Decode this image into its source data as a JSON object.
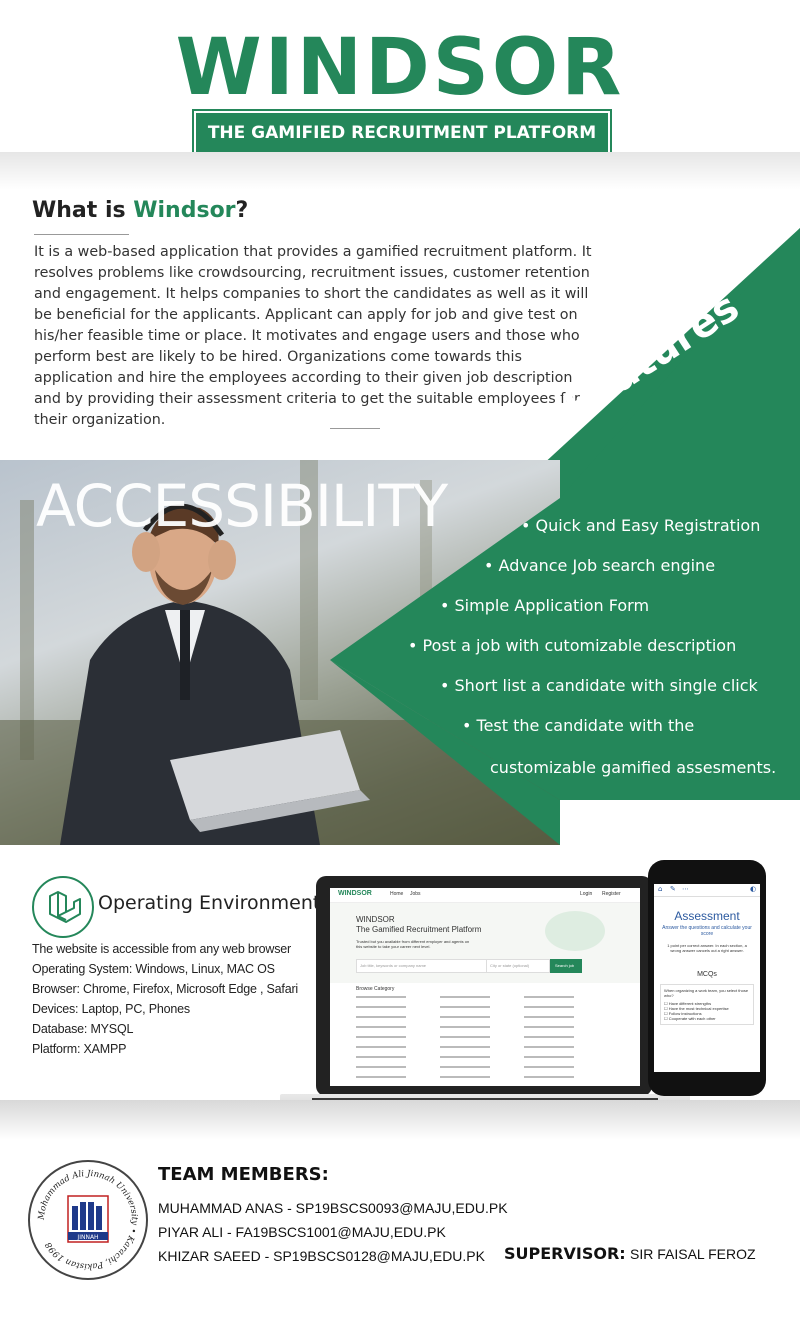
{
  "header": {
    "logo_text": "WINDSOR",
    "tagline": "THE GAMIFIED RECRUITMENT PLATFORM"
  },
  "intro": {
    "title_prefix": "What is ",
    "title_highlight": "Windsor",
    "title_suffix": "?",
    "body": "It is a web-based application that provides a gamified recruitment platform. It resolves problems like crowdsourcing, recruitment issues, customer retention and engagement. It helps companies to short the candidates as well as it will be beneficial for the applicants. Applicant can apply for job and give test on his/her feasible time or place. It motivates and engage users and those who perform best are likely to be hired. Organizations come towards this application and hire the employees according to their given job description and by providing their assessment criteria to get the suitable employees for their organization."
  },
  "photo": {
    "overlay_text": "ACCESSIBILITY"
  },
  "features": {
    "label": "Features",
    "items": [
      "• Quick and Easy Registration",
      "• Advance Job search engine",
      "• Simple Application Form",
      "• Post a job with cutomizable description",
      "• Short list a candidate with single click",
      "• Test the candidate with the",
      "customizable gamified assesments."
    ]
  },
  "environment": {
    "title": "Operating Environment",
    "lines": [
      "The website is accessible from any web browser",
      "Operating System: Windows, Linux, MAC OS",
      "Browser: Chrome, Firefox, Microsoft Edge , Safari",
      "Devices: Laptop, PC, Phones",
      "Database: MYSQL",
      "Platform: XAMPP"
    ]
  },
  "laptop_screen": {
    "nav_logo": "WINDSOR",
    "nav_links": [
      "Home",
      "Jobs"
    ],
    "nav_right": [
      "Login",
      "Register"
    ],
    "hero_line1": "WINDSOR",
    "hero_line2": "The Gamified Recruitment Platform",
    "hero_sub": "Trusted but you available from different employer and agents on this website to take your career next level.",
    "search_placeholder": "Job title, keywords or company name",
    "city_placeholder": "City or state (optional)",
    "search_button": "Search job",
    "browse_title": "Browse Category"
  },
  "phone_screen": {
    "title": "Assessment",
    "subtitle": "Answer the questions and calculate your score",
    "note": "1 point per correct answer. In each section, a wrong answer cancels out a right answer.",
    "section": "MCQs",
    "question": "When organizing a work team, you select those who?",
    "options": [
      "Have different strengths",
      "Have the most technical expertise",
      "Follow instructions",
      "Cooperate with each other"
    ]
  },
  "team": {
    "title": "TEAM MEMBERS:",
    "members": [
      "MUHAMMAD ANAS - SP19BSCS0093@MAJU,EDU.PK",
      "PIYAR ALI - FA19BSCS1001@MAJU,EDU.PK",
      "KHIZAR SAEED - SP19BSCS0128@MAJU,EDU.PK"
    ],
    "supervisor_label": "SUPERVISOR:",
    "supervisor_name": "SIR FAISAL FEROZ"
  },
  "seal": {
    "ring_text": "Mohammad Ali Jinnah University • Karachi, Pakistan 1998",
    "badge_text": "JINNAH"
  },
  "colors": {
    "brand_green": "#24875a",
    "text_dark": "#222222",
    "white": "#ffffff"
  }
}
